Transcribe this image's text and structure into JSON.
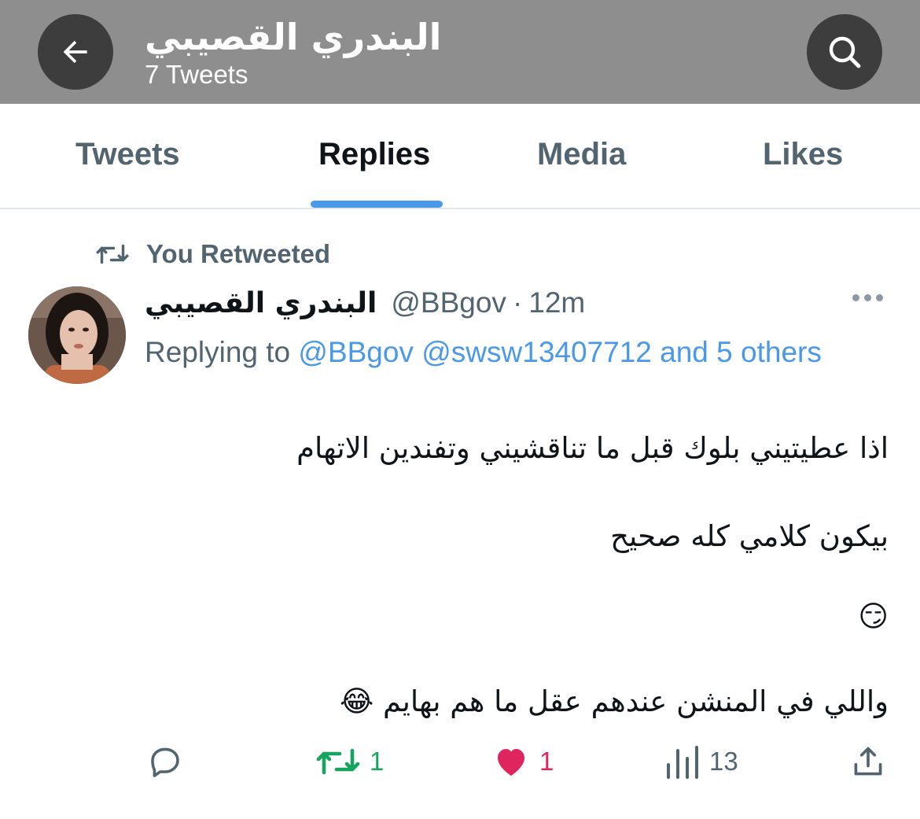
{
  "header": {
    "title": "البندري القصيبي",
    "subtitle": "7 Tweets"
  },
  "tabs": [
    {
      "label": "Tweets",
      "active": false
    },
    {
      "label": "Replies",
      "active": true
    },
    {
      "label": "Media",
      "active": false
    },
    {
      "label": "Likes",
      "active": false
    }
  ],
  "tweet": {
    "context_label": "You Retweeted",
    "author_name": "البندري القصيبي",
    "handle": "@BBgov",
    "separator": "·",
    "time": "12m",
    "replying_prefix": "Replying to",
    "replying_users": "@BBgov @swsw13407712",
    "replying_suffix": "and 5 others",
    "body_lines": [
      "اذا عطيتيني بلوك قبل ما تناقشيني وتفندين الاتهام",
      "بيكون كلامي كله صحيح",
      "😏",
      "واللي في المنشن عندهم عقل ما هم بهايم 😂"
    ],
    "actions": {
      "reply_icon": "speech-bubble-icon",
      "retweet_icon": "retweet-icon",
      "retweet_count": "1",
      "like_icon": "heart-icon",
      "like_count": "1",
      "views_icon": "bar-chart-icon",
      "views_count": "13",
      "share_icon": "share-icon"
    }
  },
  "colors": {
    "header_bg": "#8e8e8e",
    "accent": "#4a99e9",
    "retweet_green": "#17a45f",
    "like_pink": "#e0245e",
    "muted_text": "#536471"
  }
}
